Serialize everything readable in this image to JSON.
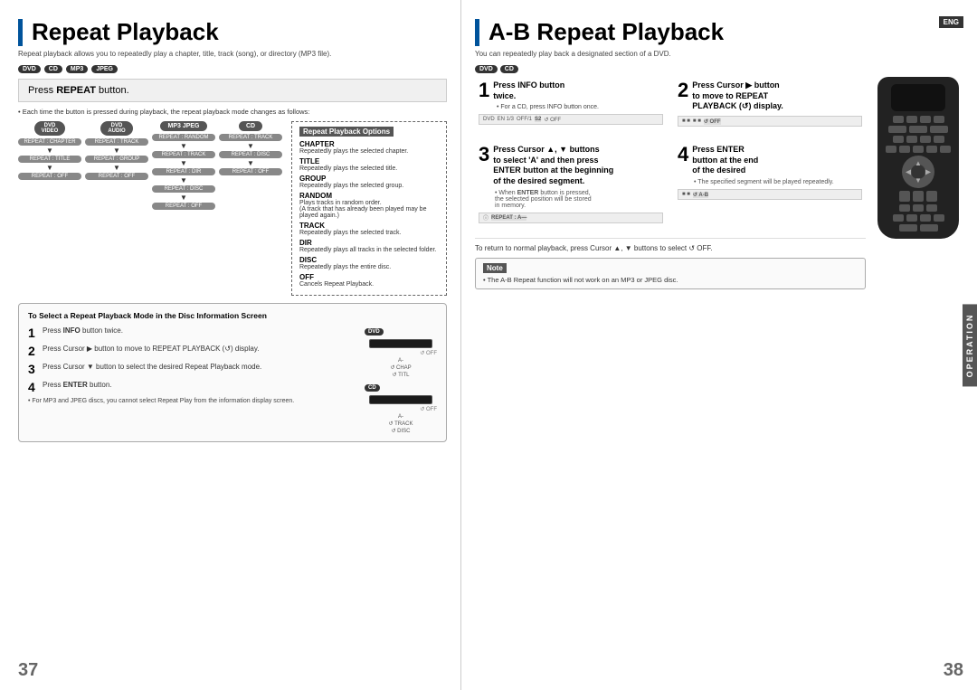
{
  "left_page": {
    "title": "Repeat Playback",
    "subtitle": "Repeat playback allows you to repeatedly play a chapter, title, track (song), or directory (MP3 file).",
    "badges": [
      "DVD",
      "CD",
      "MP3",
      "JPEG"
    ],
    "press_repeat": {
      "label": "Press ",
      "button": "REPEAT",
      "suffix": " button."
    },
    "bullet_note": "• Each time the button is pressed during playback, the repeat playback mode changes as follows:",
    "dvd_video_header": "DVD VIDEO",
    "dvd_audio_header": "DVD AUDIO",
    "mp3_jpeg_header": "MP3  JPEG",
    "cd_header": "CD",
    "dvd_video_items": [
      "REPEAT : CHAPTER",
      "REPEAT : TITLE",
      "REPEAT : OFF"
    ],
    "dvd_audio_items": [
      "REPEAT : TRACK",
      "REPEAT : GROUP",
      "REPEAT : OFF"
    ],
    "mp3_jpeg_items": [
      "REPEAT : RANDOM",
      "REPEAT : TRACK",
      "REPEAT : DIR",
      "REPEAT : DISC",
      "REPEAT : OFF"
    ],
    "cd_items": [
      "REPEAT : TRACK",
      "REPEAT : DISC",
      "REPEAT : OFF"
    ],
    "options_title": "Repeat Playback Options",
    "options": [
      {
        "name": "CHAPTER",
        "desc": "Repeatedly plays the selected chapter."
      },
      {
        "name": "TITLE",
        "desc": "Repeatedly plays the selected title."
      },
      {
        "name": "GROUP",
        "desc": "Repeatedly plays the selected group."
      },
      {
        "name": "RANDOM",
        "desc": "Plays tracks in random order.\n(A track that has already been played may be played again.)"
      },
      {
        "name": "TRACK",
        "desc": "Repeatedly plays the selected track."
      },
      {
        "name": "DIR",
        "desc": "Repeatedly plays all tracks in the selected folder."
      },
      {
        "name": "DISC",
        "desc": "Repeatedly plays the entire disc."
      },
      {
        "name": "OFF",
        "desc": "Cancels Repeat Playback."
      }
    ],
    "disc_info_title": "To Select a Repeat Playback Mode in the Disc Information Screen",
    "steps": [
      {
        "num": "1",
        "text": "Press INFO button twice."
      },
      {
        "num": "2",
        "text": "Press Cursor ▶ button to move to REPEAT PLAYBACK (↺) display."
      },
      {
        "num": "3",
        "text": "Press Cursor ▼ button to select the desired Repeat Playback mode."
      },
      {
        "num": "4",
        "text": "Press ENTER button."
      }
    ],
    "footnote": "• For MP3 and JPEG discs, you cannot select Repeat Play from the information display screen.",
    "page_num": "37"
  },
  "right_page": {
    "title": "A-B Repeat Playback",
    "eng_badge": "ENG",
    "subtitle": "You can repeatedly play back a designated section of a DVD.",
    "badges": [
      "DVD",
      "CD"
    ],
    "steps": [
      {
        "num": "1",
        "title": "Press INFO button twice.",
        "note": "• For a CD, press INFO button once."
      },
      {
        "num": "2",
        "title": "Press Cursor ▶ button to move to REPEAT PLAYBACK (↺) display.",
        "note": ""
      },
      {
        "num": "3",
        "title": "Press Cursor ▲, ▼ buttons to select 'A' and then press ENTER button at the beginning of the desired segment.",
        "note": ""
      },
      {
        "num": "4",
        "title": "Press ENTER button at the end of the desired",
        "note": "• The specified segment will be played repeatedly."
      }
    ],
    "return_note": "To return to normal playback, press Cursor ▲, ▼ buttons to select ↺ OFF.",
    "note_title": "Note",
    "note_text": "• The A-B Repeat function will not work on an MP3 or JPEG disc.",
    "operation_label": "OPERATION",
    "page_num": "38"
  }
}
